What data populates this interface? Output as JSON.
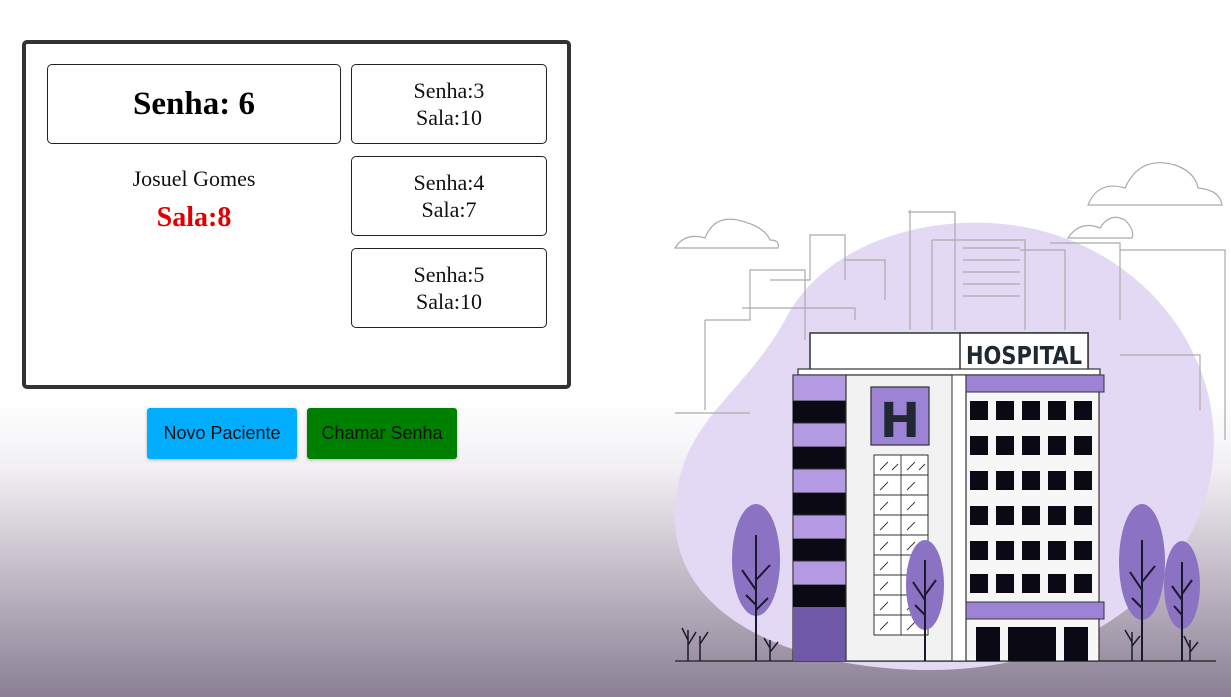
{
  "current": {
    "ticket_text": "Senha: 6",
    "patient_name": "Josuel Gomes",
    "room_text": "Sala:8"
  },
  "history": [
    {
      "ticket": "Senha:3",
      "room": "Sala:10"
    },
    {
      "ticket": "Senha:4",
      "room": "Sala:7"
    },
    {
      "ticket": "Senha:5",
      "room": "Sala:10"
    }
  ],
  "buttons": {
    "new_patient": "Novo Paciente",
    "call_ticket": "Chamar Senha"
  },
  "illustration": {
    "sign_text": "HOSPITAL",
    "h_letter": "H"
  },
  "colors": {
    "room_red": "#e00000",
    "new_button": "#00adff",
    "call_button": "#008000",
    "accent_purple": "#9d83d6",
    "blob": "#e3d9f4"
  }
}
